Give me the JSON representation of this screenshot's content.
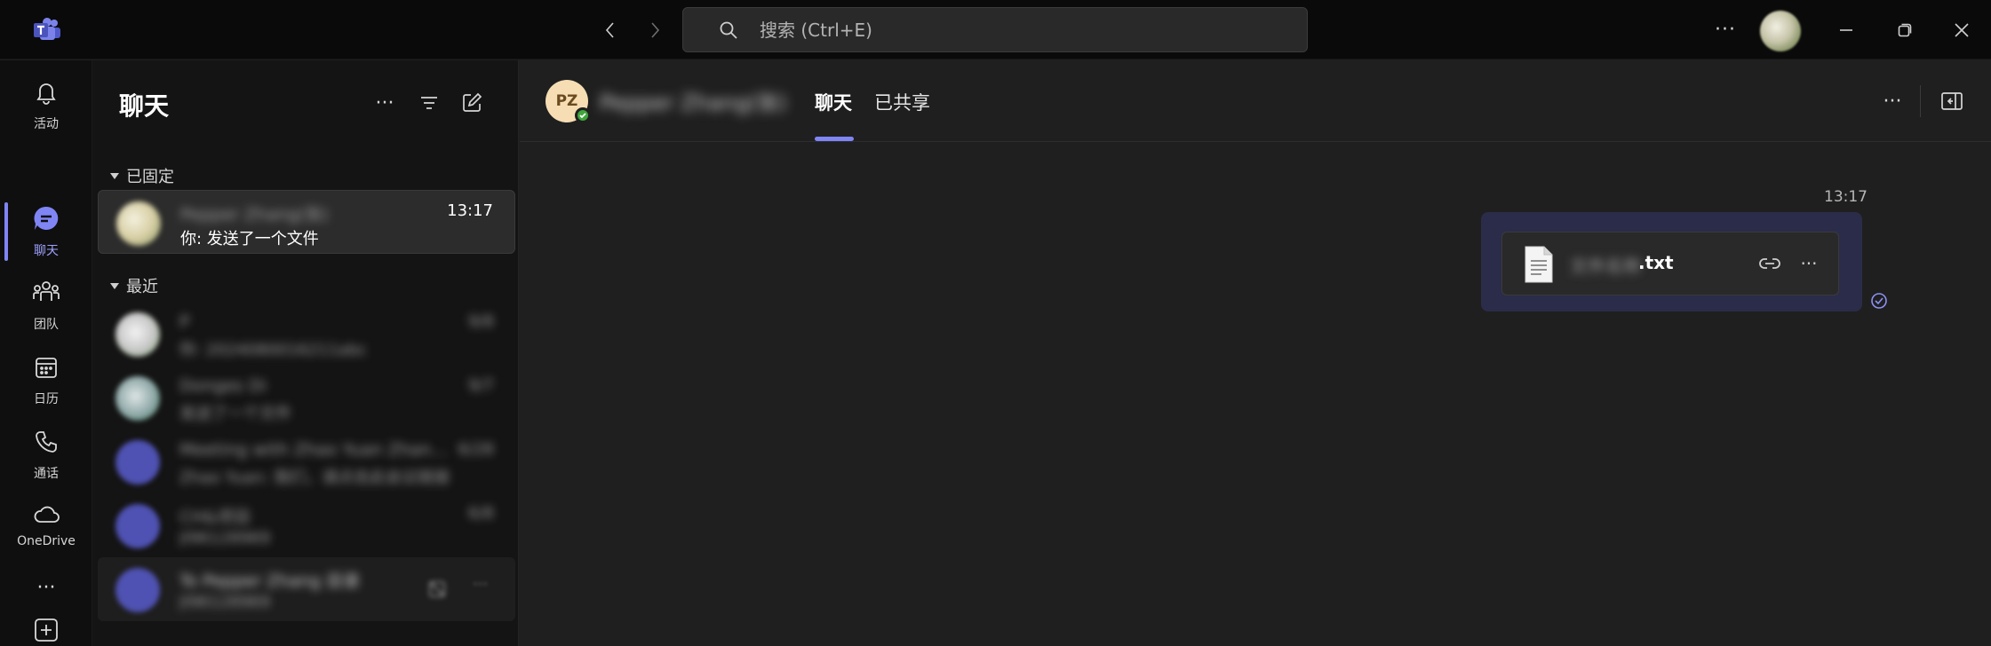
{
  "titlebar": {
    "search_placeholder": "搜索 (Ctrl+E)",
    "more_label": "···"
  },
  "rail": {
    "items": [
      {
        "label": "活动",
        "icon": "bell-icon"
      },
      {
        "label": "聊天",
        "icon": "chat-icon"
      },
      {
        "label": "团队",
        "icon": "teams-icon"
      },
      {
        "label": "日历",
        "icon": "calendar-icon"
      },
      {
        "label": "通话",
        "icon": "phone-icon"
      },
      {
        "label": "OneDrive",
        "icon": "cloud-icon"
      },
      {
        "label": "···",
        "icon": "more-icon"
      },
      {
        "label": "应用",
        "icon": "apps-icon"
      }
    ],
    "active": "聊天"
  },
  "chatlist": {
    "title": "聊天",
    "more_label": "···",
    "sections": {
      "pinned": "已固定",
      "recent": "最近"
    },
    "pinned_chats": [
      {
        "name": "Pepper Zhang(张)",
        "preview": "你: 发送了一个文件",
        "time": "13:17"
      }
    ],
    "recent_chats": [
      {
        "name": "P",
        "preview": "你: 2024080016211abc",
        "time": "9/8"
      },
      {
        "name": "Donges Di",
        "preview": "发送了一个文件",
        "time": "9/7"
      },
      {
        "name": "Meeting with Zhao Yuan Zhan…",
        "preview": "Zhao Yuan: 我们，请点击此会议链接",
        "time": "6/28"
      },
      {
        "name": "CH&项目",
        "preview": "JI96128969",
        "time": "6/8"
      },
      {
        "name": "To Pepper Zhang 目录",
        "preview": "JI96128969",
        "time": ""
      }
    ]
  },
  "chat": {
    "avatar_initials": "PZ",
    "contact_name": "Pepper Zhang(张)",
    "tabs": [
      "聊天",
      "已共享"
    ],
    "active_tab": "聊天",
    "more_label": "···",
    "message": {
      "time": "13:17",
      "file_name_hidden": "文件名称",
      "file_ext": ".txt",
      "more_label": "···"
    }
  },
  "colors": {
    "accent": "#7f85f5",
    "bubble": "#2b2c4a",
    "presence_available": "#3fa63c"
  }
}
